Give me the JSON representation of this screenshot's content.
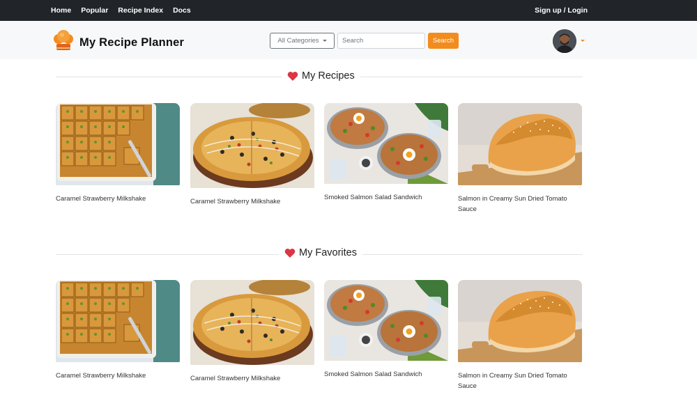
{
  "topnav": {
    "links": [
      "Home",
      "Popular",
      "Recipe Index",
      "Docs"
    ],
    "signup": "Sign up / Login"
  },
  "brand": {
    "title": "My Recipe Planner"
  },
  "search": {
    "category_label": "All Categories",
    "placeholder": "Search",
    "button_label": "Search"
  },
  "colors": {
    "accent": "#f28c1c",
    "topbar": "#212529",
    "heart": "#dc3545"
  },
  "sections": [
    {
      "title": "My Recipes",
      "cards": [
        {
          "caption": "Caramel Strawberry Milkshake",
          "image": "baklava"
        },
        {
          "caption": "Caramel Strawberry Milkshake",
          "image": "pizza"
        },
        {
          "caption": "Smoked Salmon Salad Sandwich",
          "image": "salad-bowls"
        },
        {
          "caption": "Salmon in Creamy Sun Dried Tomato Sauce",
          "image": "bread-loaf"
        }
      ]
    },
    {
      "title": "My Favorites",
      "cards": [
        {
          "caption": "Caramel Strawberry Milkshake",
          "image": "baklava"
        },
        {
          "caption": "Caramel Strawberry Milkshake",
          "image": "pizza"
        },
        {
          "caption": "Smoked Salmon Salad Sandwich",
          "image": "salad-bowls"
        },
        {
          "caption": "Salmon in Creamy Sun Dried Tomato Sauce",
          "image": "bread-loaf"
        }
      ]
    }
  ]
}
